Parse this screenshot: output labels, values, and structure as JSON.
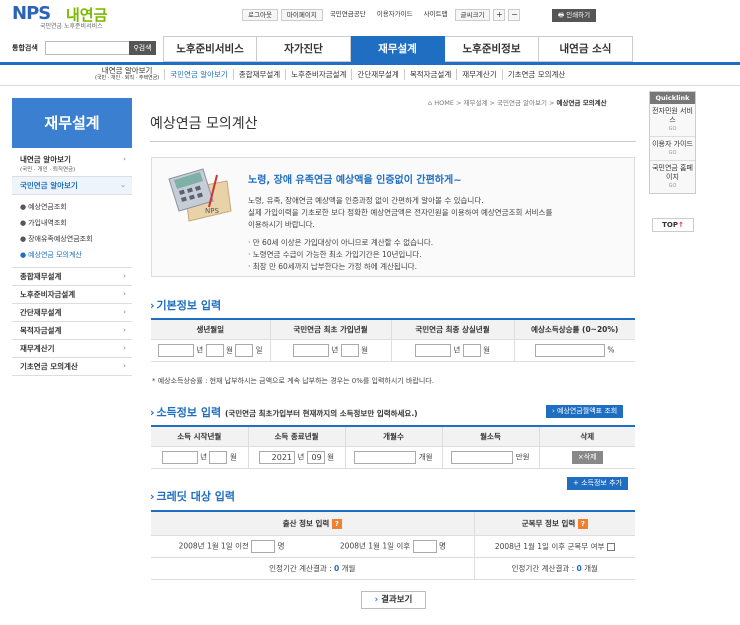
{
  "header": {
    "logo_main": "NPS",
    "logo_kr": "내연금",
    "logo_sub": "국민연금 노후준비서비스",
    "top_links": [
      "로그아웃",
      "마이페이지"
    ],
    "plain_links": [
      "국민연금공단",
      "이용자가이드",
      "사이트맵"
    ],
    "font_size_label": "글씨크기",
    "font_plus": "+",
    "font_minus": "−",
    "print_label": "인쇄하기",
    "search_label": "통합검색",
    "search_value": "",
    "search_btn": "검색"
  },
  "gnb": [
    "노후준비서비스",
    "자가진단",
    "재무설계",
    "노후준비정보",
    "내연금 소식"
  ],
  "subnav": {
    "first_line1": "내연금 알아보기",
    "first_line2": "(국민 · 개인 · 퇴직 · 주택연금)",
    "items": [
      "국민연금 알아보기",
      "종합재무설계",
      "노후준비자금설계",
      "간단재무설계",
      "목적자금설계",
      "재무계산기",
      "기초연금 모의계산"
    ]
  },
  "lnav": {
    "title": "재무설계",
    "item0": "내연금 알아보기",
    "item0_sub": "(국민 · 개인 · 퇴직연금)",
    "item1": "국민연금 알아보기",
    "subs": [
      "예상연금조회",
      "가입내역조회",
      "장애유족예상연금조회",
      "예상연금 모의계산"
    ],
    "items": [
      "종합재무설계",
      "노후준비자금설계",
      "간단재무설계",
      "목적자금설계",
      "재무계산기",
      "기초연금 모의계산"
    ]
  },
  "quick": {
    "title": "Quicklink",
    "items": [
      "전자민원 서비스",
      "이용자 가이드",
      "국민연금 홈페이지"
    ],
    "go": "GO",
    "top": "TOP"
  },
  "breadcrumb": {
    "path": "HOME > 재무설계 > 국민연금 알아보기 >",
    "current": "예상연금 모의계산"
  },
  "page_title": "예상연금 모의계산",
  "info": {
    "headline": "노령, 장애 유족연금 예상액을 인증없이 간편하게~",
    "lines": [
      "노령, 유족, 장애연금 예상액을 인증과정 없이 간편하게 알아볼 수 있습니다.",
      "실제 가입이력을 기초로한 보다 정확한 예상연금액은 전자민원을 이용하여 예상연금조회 서비스를",
      "이용하시기 바랍니다."
    ],
    "bullets": [
      "· 만 60세 이상은 가입대상이 아니므로 계산할 수 없습니다.",
      "· 노령연금 수급이 가능한 최소 가입기간은 10년입니다.",
      "· 최장 만 60세까지 납부한다는 가정 하에 계산됩니다."
    ]
  },
  "basic": {
    "title": "기본정보 입력",
    "headers": [
      "생년월일",
      "국민연금 최초 가입년월",
      "국민연금 최종 상실년월",
      "예상소득상승률 (0~20%)"
    ],
    "year": "년",
    "month": "월",
    "day": "일",
    "percent": "%",
    "note": "* 예상소득상승률 : 현재 납부하시는 금액으로 계속 납부하는 경우는 0%를 입력하시기 바랍니다."
  },
  "income": {
    "title": "소득정보 입력",
    "subtitle": "(국민연금 최초가입부터 현재까지의 소득정보만 입력하세요.)",
    "lookup_btn": "예상연금월액표 조회",
    "headers": [
      "소득 시작년월",
      "소득 종료년월",
      "개월수",
      "월소득",
      "삭제"
    ],
    "end_year": "2021",
    "end_month": "09",
    "months_unit": "개월",
    "won_unit": "만원",
    "delete_btn": "삭제",
    "add_btn": "소득정보 추가"
  },
  "credit": {
    "title": "크레딧 대상 입력",
    "birth_header": "출산 정보 입력",
    "army_header": "군복무 정보 입력",
    "before_label": "2008년 1월 1일 이전",
    "after_label": "2008년 1월 1일 이후",
    "person_unit": "명",
    "army_label": "2008년 1월 1일 이후 군복무 여부",
    "result_prefix": "인정기간 계산결과 :",
    "result_value": "0",
    "result_unit": "개월"
  },
  "result_btn": "결과보기"
}
